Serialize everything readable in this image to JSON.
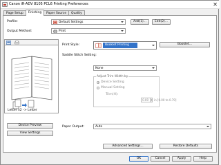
{
  "window": {
    "title": "Canon iR-ADV 8105 PCL6 Printing Preferences",
    "close": "✕"
  },
  "tabs": [
    {
      "label": "Page Setup",
      "active": false
    },
    {
      "label": "Finishing",
      "active": true
    },
    {
      "label": "Paper Source",
      "active": false
    },
    {
      "label": "Quality",
      "active": false
    }
  ],
  "profile": {
    "label": "Profile:",
    "value": "Default Settings",
    "add_button": "Add(1)...",
    "edit_button": "Edit(2)..."
  },
  "output_method": {
    "label": "Output Method:",
    "value": "Print"
  },
  "preview": {
    "caption": "Letter x2 -> Letter",
    "device_preview_button": "Device Preview",
    "view_settings_button": "View Settings"
  },
  "print_style": {
    "label": "Print Style:",
    "value": "Booklet Printing",
    "booklet_button": "Booklet..."
  },
  "saddle_stitch": {
    "label": "Saddle Stitch Setting:",
    "value": "None"
  },
  "adjust_trim": {
    "legend": "Adjust Trim Width by",
    "device_setting": "Device Setting",
    "manual_setting": "Manual Setting",
    "trim_label": "Trim(H):",
    "trim_value": "0.00",
    "trim_range": "in [0.00 to 0.79]"
  },
  "paper_output": {
    "label": "Paper Output:",
    "value": "Auto"
  },
  "advanced_settings_button": "Advanced Settings...",
  "restore_defaults_button": "Restore Defaults",
  "dialog_buttons": {
    "ok": "OK",
    "cancel": "Cancel",
    "apply": "Apply",
    "help": "Help"
  },
  "colors": {
    "selection": "#3373c9",
    "panel": "#ffffff",
    "window": "#f0f0f0"
  }
}
